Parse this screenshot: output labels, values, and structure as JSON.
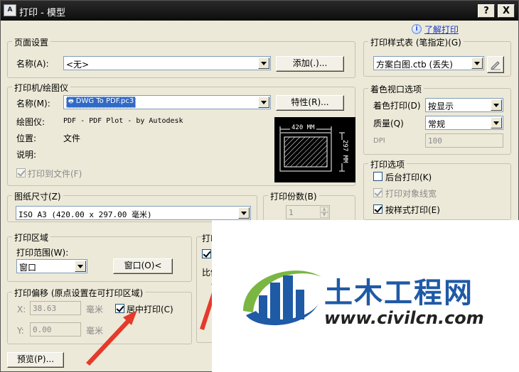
{
  "window": {
    "app_icon": "A",
    "title": "打印 - 模型",
    "help_btn": "?",
    "close_btn": "X",
    "help_link": "了解打印",
    "help_icon_glyph": "i"
  },
  "page_setup": {
    "title": "页面设置",
    "name_label": "名称(A):",
    "name_value": "<无>",
    "add_button": "添加(.)..."
  },
  "printer": {
    "title": "打印机/绘图仪",
    "name_label": "名称(M):",
    "name_value": "DWG To PDF.pc3",
    "properties_button": "特性(R)...",
    "plotter_label": "绘图仪:",
    "plotter_value": "PDF - PDF Plot - by Autodesk",
    "location_label": "位置:",
    "location_value": "文件",
    "description_label": "说明:",
    "print_to_file": "打印到文件(F)",
    "preview_width": "420 MM",
    "preview_height": "297 MM"
  },
  "paper_size": {
    "title": "图纸尺寸(Z)",
    "value": "ISO A3 (420.00 x 297.00 毫米)"
  },
  "copies": {
    "title": "打印份数(B)",
    "value": "1"
  },
  "plot_area": {
    "title": "打印区域",
    "range_label": "打印范围(W):",
    "range_value": "窗口",
    "window_button": "窗口(O)<"
  },
  "plot_offset": {
    "title": "打印偏移 (原点设置在可打印区域)",
    "x_label": "X:",
    "x_value": "38.63",
    "x_unit": "毫米",
    "y_label": "Y:",
    "y_value": "0.00",
    "y_unit": "毫米",
    "center_plot": "居中打印(C)"
  },
  "plot_scale": {
    "title_partial": "打印",
    "scale_partial": "比例"
  },
  "preview_button": "预览(P)...",
  "plot_style": {
    "title": "打印样式表 (笔指定)(G)",
    "value": "方案白图.ctb (丢失)"
  },
  "shaded": {
    "title": "着色视口选项",
    "shade_label": "着色打印(D)",
    "shade_value": "按显示",
    "quality_label": "质量(Q)",
    "quality_value": "常规",
    "dpi_label": "DPI",
    "dpi_value": "100"
  },
  "plot_options": {
    "title": "打印选项",
    "background": "后台打印(K)",
    "lineweights": "打印对象线宽",
    "styles": "按样式打印(E)"
  },
  "watermark": {
    "text_cn": "土木工程网",
    "url": "www.civilcn.com"
  },
  "colors": {
    "logo_blue": "#1f5aa6",
    "logo_green": "#7ab642",
    "arrow_red": "#e53a2b",
    "title_bar": "#111111"
  }
}
